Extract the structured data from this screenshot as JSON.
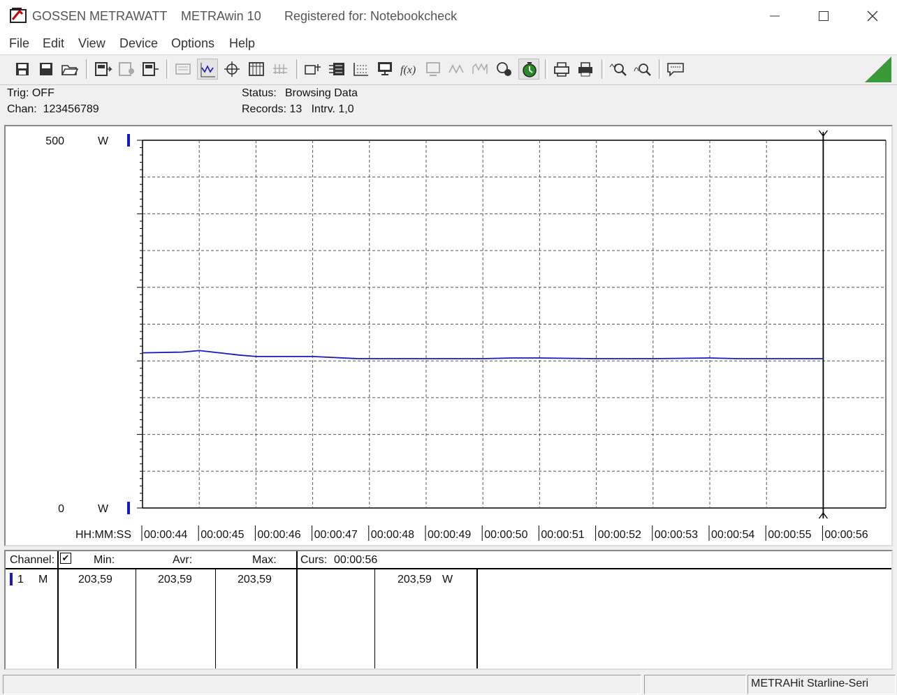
{
  "titlebar": {
    "company": "GOSSEN METRAWATT",
    "app": "METRAwin 10",
    "registered": "Registered for: Notebookcheck"
  },
  "menu": [
    "File",
    "Edit",
    "View",
    "Device",
    "Options",
    "Help"
  ],
  "status": {
    "trig": "Trig: OFF",
    "chan": "Chan:  123456789",
    "status_label": "Status:",
    "status_value": "Browsing Data",
    "records": "Records: 13   Intrv. 1,0"
  },
  "chart_data": {
    "type": "line",
    "ylim": [
      0,
      500
    ],
    "y_top_label": "500",
    "y_bottom_label": "0",
    "y_unit": "W",
    "xlabel": "HH:MM:SS",
    "x_ticks": [
      "00:00:44",
      "00:00:45",
      "00:00:46",
      "00:00:47",
      "00:00:48",
      "00:00:49",
      "00:00:50",
      "00:00:51",
      "00:00:52",
      "00:00:53",
      "00:00:54",
      "00:00:55",
      "00:00:56"
    ],
    "series": [
      {
        "color": "#1a1ab8",
        "values": [
          211,
          212,
          214,
          208,
          206,
          206,
          203,
          203,
          203,
          203,
          204,
          204,
          203,
          203,
          203,
          204,
          203,
          203,
          203
        ]
      }
    ],
    "series_x_index": [
      0,
      0.7,
      1,
      1.7,
      2,
      3,
      3.8,
      4,
      5,
      6,
      6.5,
      7,
      8,
      8.5,
      9,
      10,
      10.5,
      11,
      12
    ],
    "cursor_tick": "00:00:56",
    "grid": true
  },
  "table": {
    "channel_label": "Channel:",
    "min_label": "Min:",
    "avr_label": "Avr:",
    "max_label": "Max:",
    "curs_label": "Curs:",
    "curs_time": "00:00:56",
    "row": {
      "num": "1",
      "mode": "M",
      "min": "203,59",
      "avr": "203,59",
      "max": "203,59",
      "curs_value": "203,59",
      "unit": "W"
    }
  },
  "statusbar": {
    "device": "METRAHit Starline-Seri"
  }
}
